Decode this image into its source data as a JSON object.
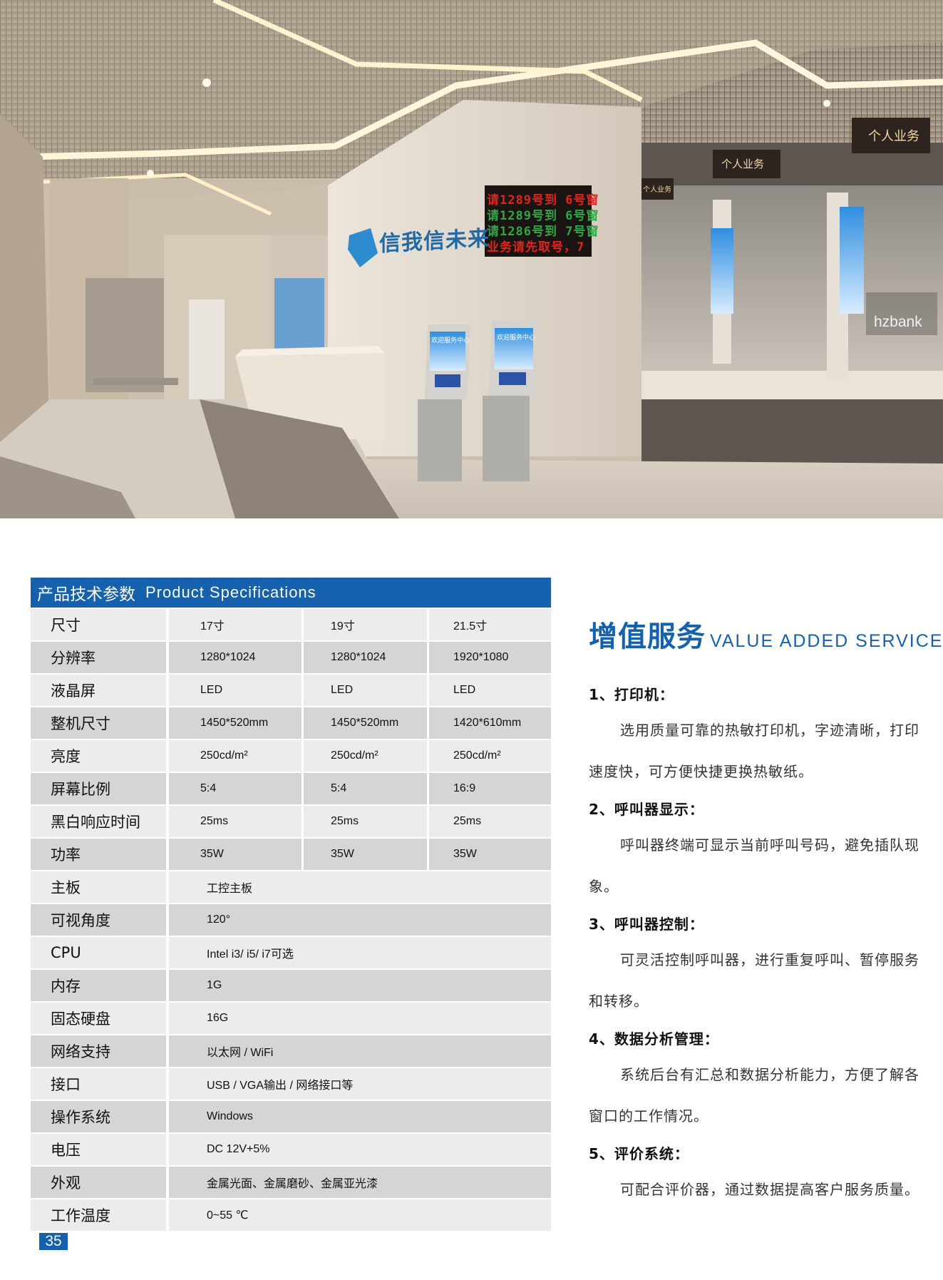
{
  "photo": {
    "wall_slogan": "信我信未来",
    "led_lines": [
      "请1289号到 6号窗",
      "请1289号到 6号窗",
      "请1286号到 7号窗",
      "业务请先取号，7"
    ],
    "counter_signs": [
      "个人业务",
      "个人业务",
      "个人业务"
    ],
    "kiosk_screen_text": "欢迎服务中心",
    "bank_logo_text": "hzbank"
  },
  "spec_table": {
    "title_cn": "产品技术参数",
    "title_en": "Product Specifications",
    "rows": [
      {
        "label": "尺寸",
        "v1": "17寸",
        "v2": "19寸",
        "v3": "21.5寸"
      },
      {
        "label": "分辨率",
        "v1": "1280*1024",
        "v2": "1280*1024",
        "v3": "1920*1080"
      },
      {
        "label": "液晶屏",
        "v1": "LED",
        "v2": "LED",
        "v3": "LED"
      },
      {
        "label": "整机尺寸",
        "v1": "1450*520mm",
        "v2": "1450*520mm",
        "v3": "1420*610mm"
      },
      {
        "label": "亮度",
        "v1": "250cd/m²",
        "v2": "250cd/m²",
        "v3": "250cd/m²"
      },
      {
        "label": "屏幕比例",
        "v1": "5:4",
        "v2": "5:4",
        "v3": "16:9"
      },
      {
        "label": "黑白响应时间",
        "v1": "25ms",
        "v2": "25ms",
        "v3": "25ms"
      },
      {
        "label": "功率",
        "v1": "35W",
        "v2": "35W",
        "v3": "35W"
      }
    ],
    "span_rows": [
      {
        "label": "主板",
        "value": "工控主板"
      },
      {
        "label": "可视角度",
        "value": "120°"
      },
      {
        "label": "CPU",
        "value": "Intel i3/ i5/ i7可选"
      },
      {
        "label": "内存",
        "value": "1G"
      },
      {
        "label": "固态硬盘",
        "value": "16G"
      },
      {
        "label": "网络支持",
        "value": "以太网 / WiFi"
      },
      {
        "label": "接口",
        "value": "USB / VGA输出 / 网络接口等"
      },
      {
        "label": "操作系统",
        "value": "Windows"
      },
      {
        "label": "电压",
        "value": "DC 12V+5%"
      },
      {
        "label": "外观",
        "value": "金属光面、金属磨砂、金属亚光漆"
      },
      {
        "label": "工作温度",
        "value": "0~55 ℃"
      }
    ]
  },
  "page_number": "35",
  "service": {
    "title_cn": "增值服务",
    "title_en": "VALUE ADDED SERVICE",
    "items": [
      {
        "heading": "1、打印机：",
        "desc": "选用质量可靠的热敏打印机，字迹清晰，打印速度快，可方便快捷更换热敏纸。"
      },
      {
        "heading": "2、呼叫器显示：",
        "desc": "呼叫器终端可显示当前呼叫号码，避免插队现象。"
      },
      {
        "heading": "3、呼叫器控制：",
        "desc": "可灵活控制呼叫器，进行重复呼叫、暂停服务和转移。"
      },
      {
        "heading": "4、数据分析管理：",
        "desc": "系统后台有汇总和数据分析能力，方便了解各窗口的工作情况。"
      },
      {
        "heading": "5、评价系统：",
        "desc": "可配合评价器，通过数据提高客户服务质量。"
      }
    ]
  },
  "colors": {
    "brand_blue": "#1561ad",
    "row_light": "#ececec",
    "row_dark": "#d5d5d5"
  }
}
